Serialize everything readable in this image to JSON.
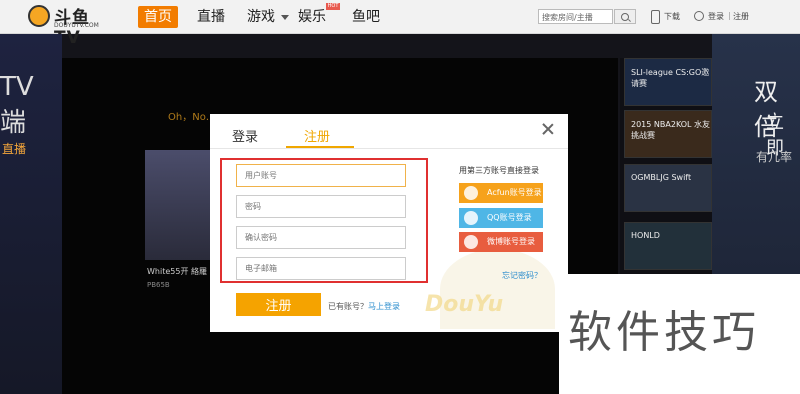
{
  "header": {
    "logo_text": "斗鱼TV",
    "logo_sub": "DOUYUTV.COM",
    "nav": [
      {
        "label": "首页",
        "active": true
      },
      {
        "label": "直播"
      },
      {
        "label": "游戏"
      },
      {
        "label": "娱乐"
      },
      {
        "label": "鱼吧"
      }
    ],
    "hot_badge": "HOT",
    "search_placeholder": "搜索房间/主播",
    "download_label": "下载",
    "login_label": "登录",
    "register_label": "注册"
  },
  "background": {
    "left_lines": [
      "TV",
      "端"
    ],
    "left_small": "直播",
    "notice": "Oh，No……",
    "video_title": "White55开 絡羅",
    "video_meta": "PB65B",
    "sidebar_cards": [
      {
        "text": "SLI-league CS:GO邀请赛"
      },
      {
        "text": "2015 NBA2KOL 水友挑战赛"
      },
      {
        "text": "OGMBLJG Swift"
      },
      {
        "text": "HONLD"
      }
    ],
    "right_big": "双倍",
    "right_mid": "立即",
    "right_small": "有几率"
  },
  "modal": {
    "tabs": [
      "登录",
      "注册"
    ],
    "active_tab": "注册",
    "fields": {
      "username": "用户账号",
      "password": "密码",
      "confirm": "确认密码",
      "email": "电子邮箱"
    },
    "submit": "注册",
    "have_account": "已有账号？",
    "login_link": "马上登录",
    "third_title": "用第三方账号直接登录",
    "third_buttons": [
      "Acfun账号登录",
      "QQ账号登录",
      "微博账号登录"
    ],
    "forgot": "忘记密码？",
    "mascot_text": "DouYu"
  },
  "watermark": "软件技巧"
}
